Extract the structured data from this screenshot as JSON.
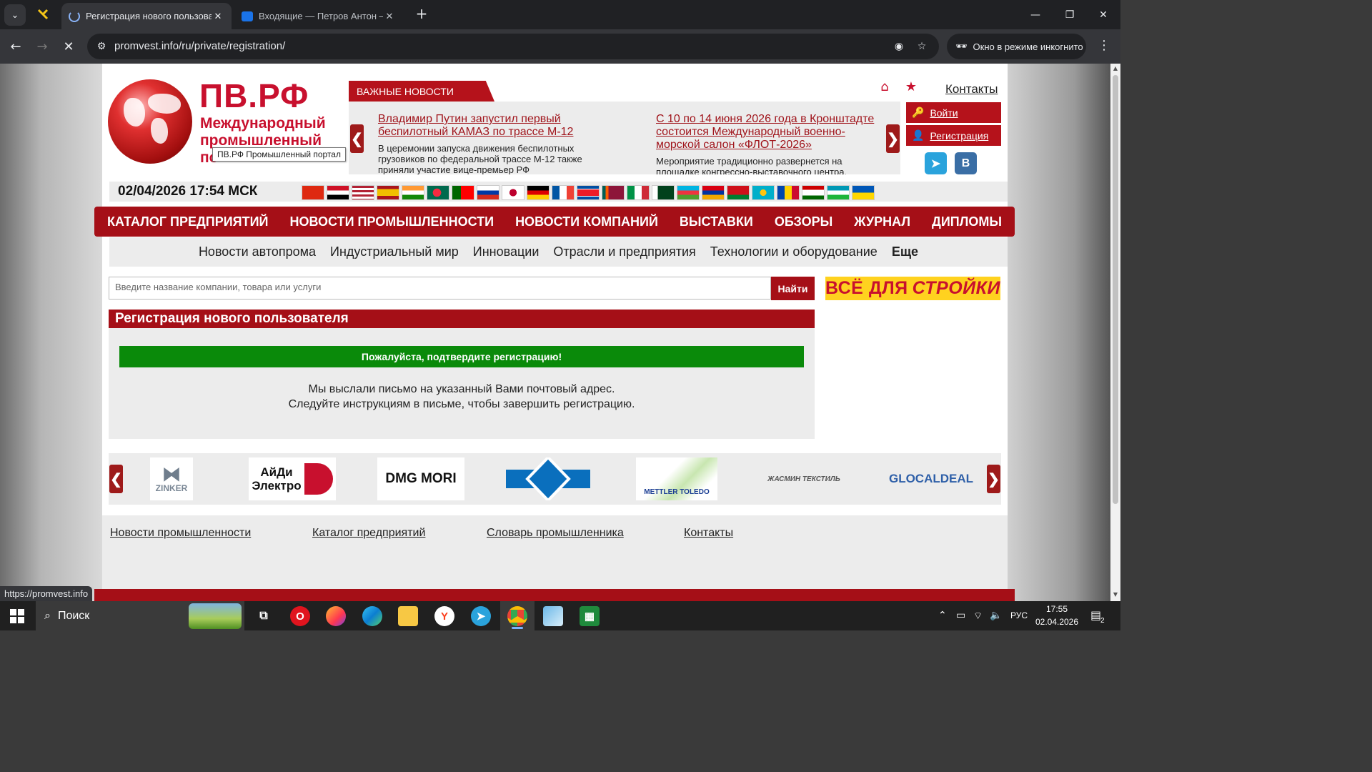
{
  "browser": {
    "tabs": [
      {
        "title": "Регистрация нового пользова"
      },
      {
        "title": "Входящие — Петров Антон —"
      }
    ],
    "url": "promvest.info/ru/private/registration/",
    "incognito_label": "Окно в режиме инкогнито",
    "status_url": "https://promvest.info"
  },
  "header": {
    "logo_title": "ПВ.РФ",
    "logo_sub_1": "Международный",
    "logo_sub_2": "промышленный",
    "logo_sub_3": "по",
    "logo_tooltip": "ПВ.РФ Промышленный портал",
    "news_tab": "ВАЖНЫЕ НОВОСТИ",
    "news": [
      {
        "title": "Владимир Путин запустил первый беспилотный КАМАЗ по трассе М-12",
        "text": "В церемонии запуска движения беспилотных грузовиков по федеральной трассе М-12 также приняли участие вице-премьер РФ"
      },
      {
        "title": "С 10 по 14 июня 2026 года в Кронштадте состоится Международный военно-морской салон «ФЛОТ-2026»",
        "text": "Мероприятие традиционно развернется на площадке конгрессно-выставочного центра."
      }
    ],
    "contacts": "Контакты",
    "login": "Войти",
    "register": "Регистрация",
    "vk_letter": "В",
    "datetime": "02/04/2026 17:54 МСК"
  },
  "main_nav": [
    "КАТАЛОГ ПРЕДПРИЯТИЙ",
    "НОВОСТИ ПРОМЫШЛЕННОСТИ",
    "НОВОСТИ КОМПАНИЙ",
    "ВЫСТАВКИ",
    "ОБЗОРЫ",
    "ЖУРНАЛ",
    "ДИПЛОМЫ"
  ],
  "sub_nav": [
    "Новости автопрома",
    "Индустриальный мир",
    "Инновации",
    "Отрасли и предприятия",
    "Технологии и оборудование",
    "Еще"
  ],
  "search": {
    "placeholder": "Введите название компании, товара или услуги",
    "button": "Найти"
  },
  "banner": {
    "text_1": "ВСЁ ДЛЯ ",
    "text_2": "СТРОЙКИ"
  },
  "registration": {
    "title": "Регистрация нового пользователя",
    "alert": "Пожалуйста, подтвердите регистрацию!",
    "line_1": "Мы выслали письмо на указанный Вами почтовый адрес.",
    "line_2": "Следуйте инструкциям в письме, чтобы завершить регистрацию."
  },
  "partners": [
    "ZINKER",
    "АйДи Электро",
    "DMG MORI",
    "",
    "METTLER TOLEDO",
    "ЖАСМИН ТЕКСТИЛЬ",
    "GLOCALDEAL"
  ],
  "footer_links": [
    "Новости промышленности",
    "Каталог предприятий",
    "Словарь промышленника",
    "Контакты"
  ],
  "taskbar": {
    "search": "Поиск",
    "lang": "РУС",
    "time": "17:55",
    "date": "02.04.2026",
    "notif_count": "2"
  }
}
